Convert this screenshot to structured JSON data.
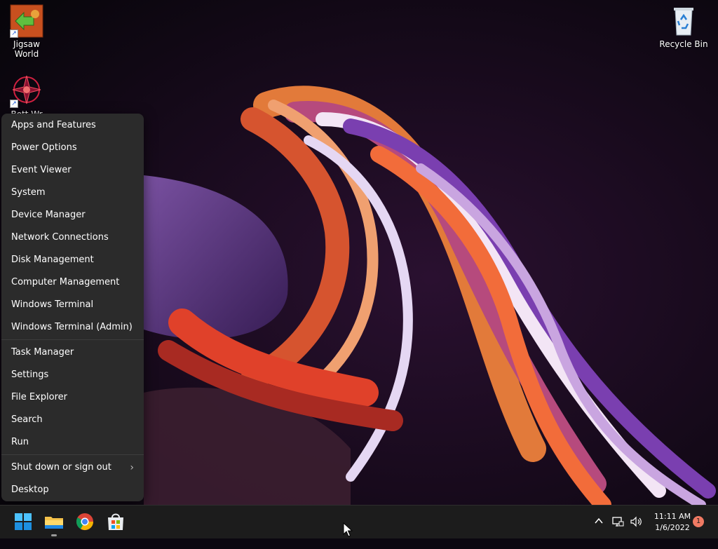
{
  "desktop": {
    "icons": [
      {
        "label": "Jigsaw World"
      },
      {
        "label": "Recycle Bin"
      },
      {
        "label": "Bott Wr"
      }
    ]
  },
  "context_menu": {
    "group1": [
      "Apps and Features",
      "Power Options",
      "Event Viewer",
      "System",
      "Device Manager",
      "Network Connections",
      "Disk Management",
      "Computer Management",
      "Windows Terminal",
      "Windows Terminal (Admin)"
    ],
    "group2": [
      "Task Manager",
      "Settings",
      "File Explorer",
      "Search",
      "Run"
    ],
    "group3": [
      "Shut down or sign out",
      "Desktop"
    ]
  },
  "taskbar": {
    "apps": [
      "start-icon",
      "file-explorer-icon",
      "chrome-icon",
      "microsoft-store-icon"
    ],
    "tray_icons": [
      "chevron-up-icon",
      "network-icon",
      "volume-icon"
    ],
    "time": "11:11 AM",
    "date": "1/6/2022",
    "notification_count": "1"
  },
  "colors": {
    "accent": "#0078d4",
    "menu_bg": "#2b2b2b",
    "taskbar_bg": "#1c1c1c",
    "badge": "#f07a63"
  }
}
